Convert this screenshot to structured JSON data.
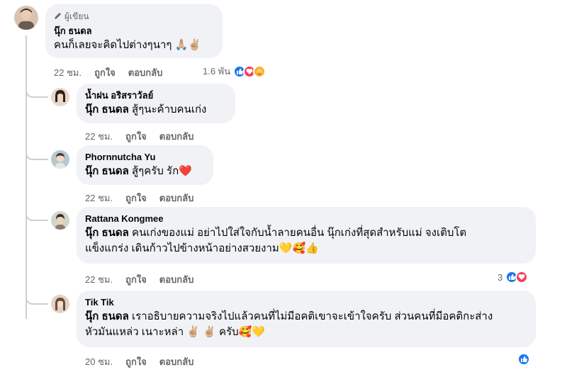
{
  "comments": [
    {
      "badge": "ผู้เขียน",
      "name": "นุ๊ก ธนดล",
      "text": "คนก็เลยจะคิดไปต่างๆนาๆ",
      "emojis": "🙏🏼✌🏼",
      "time": "22 ชม.",
      "like": "ถูกใจ",
      "reply": "ตอบกลับ",
      "reaction_count": "1.6 พัน"
    },
    {
      "name": "น้ำฝน อริสราวัลย์",
      "mention": "นุ๊ก ธนดล",
      "text": "สู้ๆนะค้าบคนเก่ง",
      "time": "22 ชม.",
      "like": "ถูกใจ",
      "reply": "ตอบกลับ"
    },
    {
      "name": "Phornnutcha Yu",
      "mention": "นุ๊ก ธนดล",
      "text": "สู้ๆครับ รัก",
      "emojis": "❤️",
      "time": "22 ชม.",
      "like": "ถูกใจ",
      "reply": "ตอบกลับ"
    },
    {
      "name": "Rattana Kongmee",
      "mention": "นุ๊ก ธนดล",
      "text_line1": "คนเก่งของแม่ อย่าไปใส่ใจกับน้ำลายคนอื่น นุ๊กเก่งที่สุดสำหรับแม่ จงเติบโต",
      "text_line2": "แข็งแกร่ง เดินก้าวไปข้างหน้าอย่างสวยงาม",
      "emojis": "💛🥰👍",
      "time": "22 ชม.",
      "like": "ถูกใจ",
      "reply": "ตอบกลับ",
      "reaction_count": "3"
    },
    {
      "name": "Tik Tik",
      "mention": "นุ๊ก ธนดล",
      "text_line1": "เราอธิบายความจริงไปแล้วคนที่ไม่มีอคติเขาจะเข้าใจครับ ส่วนคนที่มีอคติกะส่าง",
      "text_line2a": "หัวมันแหล่ว เนาะหล่า",
      "emoji_a": "✌🏼",
      "emoji_b": "✌🏼",
      "text_line2b": "ครับ",
      "emojis_end": "🥰💛",
      "time": "20 ชม.",
      "like": "ถูกใจ",
      "reply": "ตอบกลับ"
    }
  ],
  "colors": {
    "bubble": "#f0f2f5",
    "meta_text": "#65676b",
    "like": "#1877f2",
    "love": "#f33e58",
    "care": "#f7b125",
    "thread": "#ccd0d5"
  },
  "icons": {
    "badge": "pen-icon",
    "like": "thumbs-up-icon",
    "love": "heart-icon",
    "care": "care-icon"
  }
}
